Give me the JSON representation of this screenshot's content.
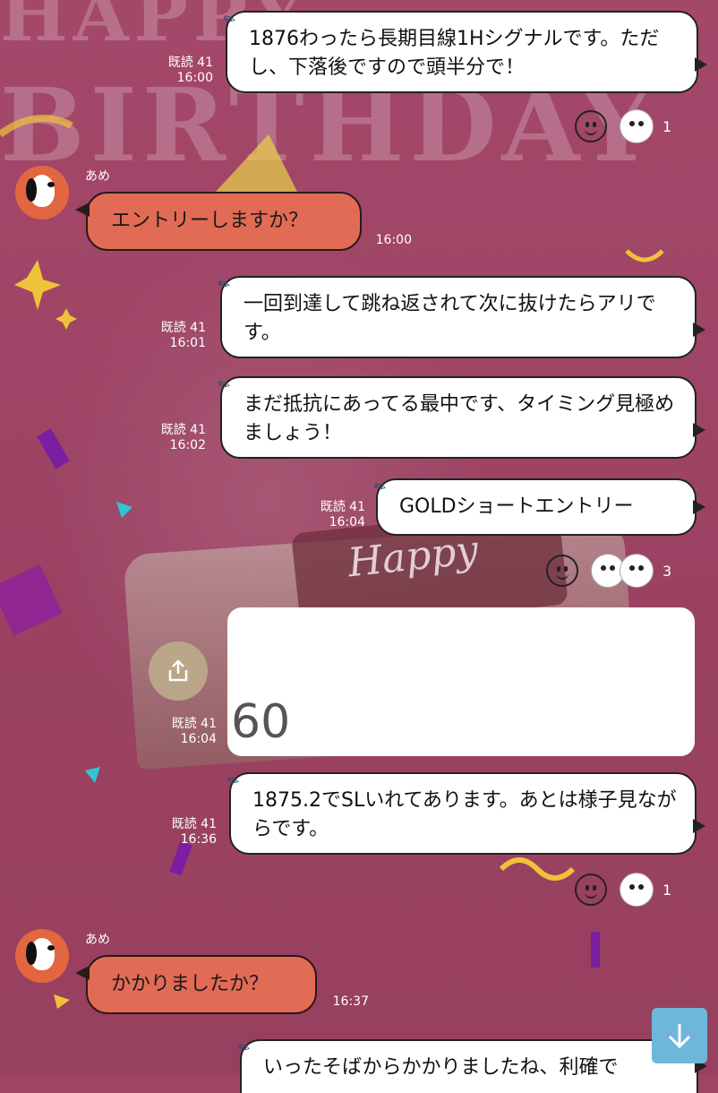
{
  "background": {
    "banner_line1": "HAPPY",
    "banner_line2": "BIRTHDAY",
    "cake_text": "Happy"
  },
  "messages": [
    {
      "type": "sent",
      "read": "既読 41",
      "time": "16:00",
      "text": "1876わったら長期目線1Hシグナルです。ただし、下落後ですので頭半分で！"
    },
    {
      "type": "received",
      "sender": "あめ",
      "time": "16:00",
      "text": "エントリーしますか？"
    },
    {
      "type": "sent",
      "read": "既読 41",
      "time": "16:01",
      "text": "一回到達して跳ね返されて次に抜けたらアリです。"
    },
    {
      "type": "sent",
      "read": "既読 41",
      "time": "16:02",
      "text": "まだ抵抗にあってる最中です、タイミング見極めましょう！"
    },
    {
      "type": "sent",
      "read": "既読 41",
      "time": "16:04",
      "text": "GOLDショートエントリー"
    },
    {
      "type": "image",
      "read": "既読 41",
      "time": "16:04",
      "preview_text": "60"
    },
    {
      "type": "sent",
      "read": "既読 41",
      "time": "16:36",
      "text": "1875.2でSLいれてあります。あとは様子見ながらです。"
    },
    {
      "type": "received",
      "sender": "あめ",
      "time": "16:37",
      "text": "かかりましたか？"
    },
    {
      "type": "sent",
      "read": "",
      "time": "",
      "text": "いったそばからかかりましたね、利確で"
    }
  ],
  "reactions": [
    {
      "count": "1"
    },
    {
      "count": "3"
    },
    {
      "count": "1"
    }
  ],
  "icons": {
    "smile": "smile-reaction-icon",
    "thumbs": "thumbs-up-character-icon",
    "share": "share-icon",
    "scroll": "arrow-down-icon",
    "pin": "pin-icon"
  },
  "colors": {
    "background": "#9e4564",
    "received_bubble": "#e26b55",
    "sent_bubble": "#ffffff",
    "scroll_button": "#6fb6dd"
  }
}
